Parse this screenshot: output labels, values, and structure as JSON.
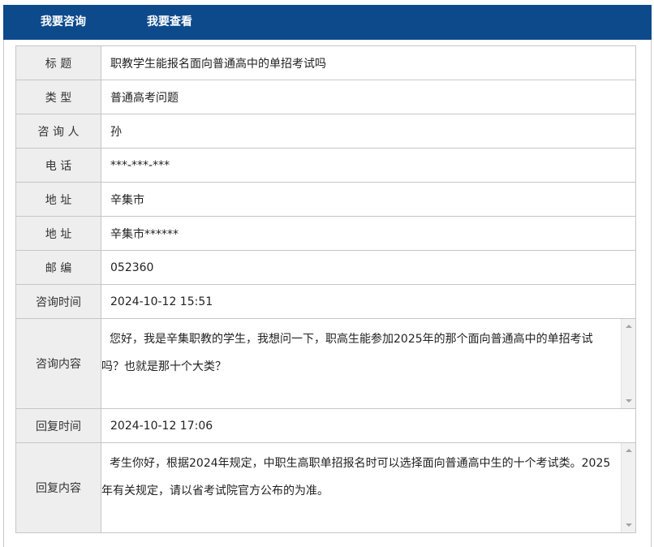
{
  "tabs": [
    "我要咨询",
    "我要查看"
  ],
  "fields": [
    {
      "label": "标 题",
      "value": "职教学生能报名面向普通高中的单招考试吗"
    },
    {
      "label": "类 型",
      "value": "普通高考问题"
    },
    {
      "label": "咨 询 人",
      "value": "孙"
    },
    {
      "label": "电 话",
      "value": "***-***-***"
    },
    {
      "label": "地 址",
      "value": "辛集市"
    },
    {
      "label": "地 址",
      "value": "辛集市******"
    },
    {
      "label": "邮 编",
      "value": "052360"
    },
    {
      "label": "咨询时间",
      "value": "2024-10-12 15:51"
    }
  ],
  "consult_content": {
    "label": "咨询内容",
    "text": "您好，我是辛集职教的学生，我想问一下，职高生能参加2025年的那个面向普通高中的单招考试吗？也就是那十个大类？"
  },
  "reply_time": {
    "label": "回复时间",
    "value": "2024-10-12 17:06"
  },
  "reply_content": {
    "label": "回复内容",
    "text": "考生你好，根据2024年规定，中职生高职单招报名时可以选择面向普通高中生的十个考试类。2025年有关规定，请以省考试院官方公布的为准。"
  }
}
